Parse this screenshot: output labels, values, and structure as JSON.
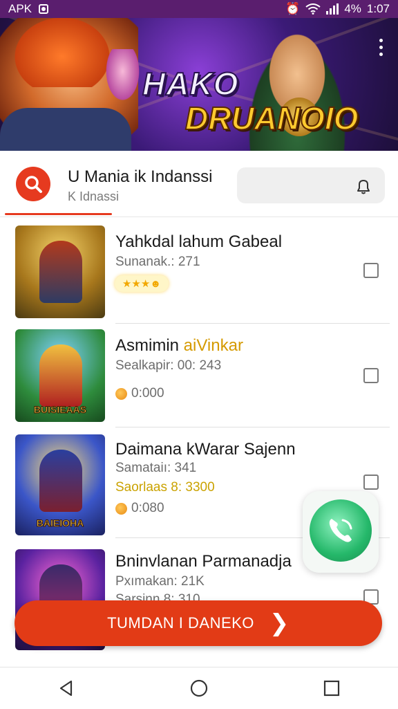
{
  "status_bar": {
    "left_text": "APK",
    "battery": "4%",
    "time": "1:07"
  },
  "banner": {
    "title_line1": "HAKO",
    "title_line2": "DRUANOIO"
  },
  "header": {
    "title": "U Mania ik Indanssi",
    "subtitle": "K Idnassi"
  },
  "games": [
    {
      "title": "Yahkdal lahum Gabeal",
      "title_highlight": "",
      "meta1": "Sunanak.: 271",
      "meta2": "",
      "extra": "",
      "stars": "★★★☻"
    },
    {
      "title": "Asmimin ",
      "title_highlight": "aiVinkar",
      "meta1": "Sealkapir: 00: 243",
      "meta2": "",
      "extra": "0:000",
      "thumb_label": "BUISIEAAS"
    },
    {
      "title": "Daimana kWarar Sajenn",
      "title_highlight": "",
      "meta1": "Samataiı: 341",
      "meta2": "Saorlaas 8: 3300",
      "extra": "0:080",
      "thumb_label": "BAIEIOHA"
    },
    {
      "title": "Bninvlanan Parmanadja",
      "title_highlight": "",
      "meta1": "Pxımakan: 21K",
      "meta2": "Sarsinn 8: 310",
      "extra": ""
    }
  ],
  "cta": {
    "label": "TUMDAN I DANEKO"
  },
  "colors": {
    "accent": "#e63a1f",
    "status_bar": "#5a1e6e",
    "call_green": "#25b86a"
  },
  "icons": {
    "search": "search-icon",
    "bell": "bell-icon",
    "call": "phone-call-icon",
    "chevron": "chevron-right-icon"
  }
}
